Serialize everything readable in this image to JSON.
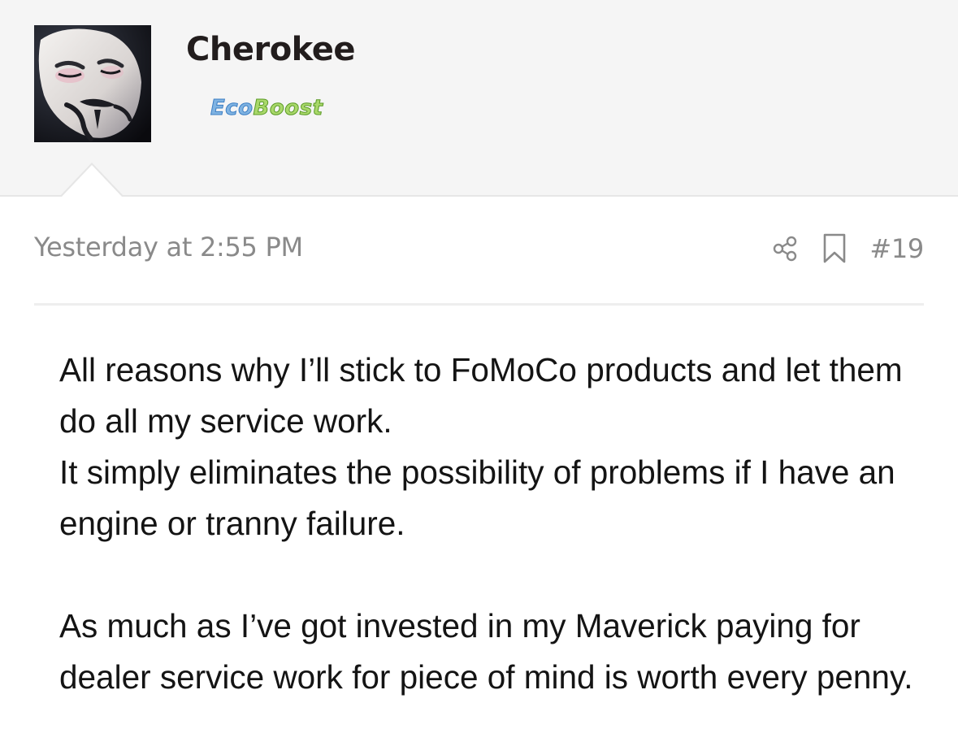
{
  "user": {
    "name": "Cherokee",
    "badge": {
      "part1": "Eco",
      "part2": "Boost",
      "color_part1": "#7fb3e2",
      "color_part2": "#a9d86a"
    },
    "avatar_icon": "guy-fawkes-mask-avatar"
  },
  "post": {
    "date": "Yesterday at 2:55 PM",
    "number": "#19",
    "actions": [
      "share-icon",
      "bookmark-icon"
    ],
    "paragraphs": [
      "All reasons why I’ll stick to FoMoCo products and let them do all my service work.",
      "It simply eliminates the possibility of problems if I have an engine or tranny failure.",
      "As much as I’ve got invested in my Maverick paying for dealer service work for piece of mind is worth every penny."
    ]
  },
  "colors": {
    "header_bg": "#f5f5f5",
    "meta_text": "#8a8a8a",
    "body_text": "#141414",
    "username_text": "#221d1d"
  }
}
